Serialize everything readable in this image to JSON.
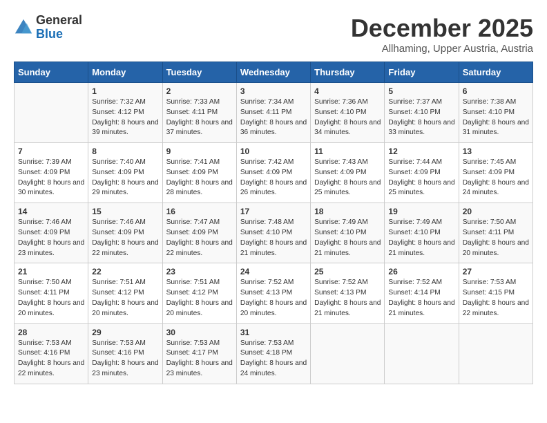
{
  "header": {
    "logo_general": "General",
    "logo_blue": "Blue",
    "title": "December 2025",
    "subtitle": "Allhaming, Upper Austria, Austria"
  },
  "weekdays": [
    "Sunday",
    "Monday",
    "Tuesday",
    "Wednesday",
    "Thursday",
    "Friday",
    "Saturday"
  ],
  "weeks": [
    [
      {
        "day": "",
        "sunrise": "",
        "sunset": "",
        "daylight": ""
      },
      {
        "day": "1",
        "sunrise": "Sunrise: 7:32 AM",
        "sunset": "Sunset: 4:12 PM",
        "daylight": "Daylight: 8 hours and 39 minutes."
      },
      {
        "day": "2",
        "sunrise": "Sunrise: 7:33 AM",
        "sunset": "Sunset: 4:11 PM",
        "daylight": "Daylight: 8 hours and 37 minutes."
      },
      {
        "day": "3",
        "sunrise": "Sunrise: 7:34 AM",
        "sunset": "Sunset: 4:11 PM",
        "daylight": "Daylight: 8 hours and 36 minutes."
      },
      {
        "day": "4",
        "sunrise": "Sunrise: 7:36 AM",
        "sunset": "Sunset: 4:10 PM",
        "daylight": "Daylight: 8 hours and 34 minutes."
      },
      {
        "day": "5",
        "sunrise": "Sunrise: 7:37 AM",
        "sunset": "Sunset: 4:10 PM",
        "daylight": "Daylight: 8 hours and 33 minutes."
      },
      {
        "day": "6",
        "sunrise": "Sunrise: 7:38 AM",
        "sunset": "Sunset: 4:10 PM",
        "daylight": "Daylight: 8 hours and 31 minutes."
      }
    ],
    [
      {
        "day": "7",
        "sunrise": "Sunrise: 7:39 AM",
        "sunset": "Sunset: 4:09 PM",
        "daylight": "Daylight: 8 hours and 30 minutes."
      },
      {
        "day": "8",
        "sunrise": "Sunrise: 7:40 AM",
        "sunset": "Sunset: 4:09 PM",
        "daylight": "Daylight: 8 hours and 29 minutes."
      },
      {
        "day": "9",
        "sunrise": "Sunrise: 7:41 AM",
        "sunset": "Sunset: 4:09 PM",
        "daylight": "Daylight: 8 hours and 28 minutes."
      },
      {
        "day": "10",
        "sunrise": "Sunrise: 7:42 AM",
        "sunset": "Sunset: 4:09 PM",
        "daylight": "Daylight: 8 hours and 26 minutes."
      },
      {
        "day": "11",
        "sunrise": "Sunrise: 7:43 AM",
        "sunset": "Sunset: 4:09 PM",
        "daylight": "Daylight: 8 hours and 25 minutes."
      },
      {
        "day": "12",
        "sunrise": "Sunrise: 7:44 AM",
        "sunset": "Sunset: 4:09 PM",
        "daylight": "Daylight: 8 hours and 25 minutes."
      },
      {
        "day": "13",
        "sunrise": "Sunrise: 7:45 AM",
        "sunset": "Sunset: 4:09 PM",
        "daylight": "Daylight: 8 hours and 24 minutes."
      }
    ],
    [
      {
        "day": "14",
        "sunrise": "Sunrise: 7:46 AM",
        "sunset": "Sunset: 4:09 PM",
        "daylight": "Daylight: 8 hours and 23 minutes."
      },
      {
        "day": "15",
        "sunrise": "Sunrise: 7:46 AM",
        "sunset": "Sunset: 4:09 PM",
        "daylight": "Daylight: 8 hours and 22 minutes."
      },
      {
        "day": "16",
        "sunrise": "Sunrise: 7:47 AM",
        "sunset": "Sunset: 4:09 PM",
        "daylight": "Daylight: 8 hours and 22 minutes."
      },
      {
        "day": "17",
        "sunrise": "Sunrise: 7:48 AM",
        "sunset": "Sunset: 4:10 PM",
        "daylight": "Daylight: 8 hours and 21 minutes."
      },
      {
        "day": "18",
        "sunrise": "Sunrise: 7:49 AM",
        "sunset": "Sunset: 4:10 PM",
        "daylight": "Daylight: 8 hours and 21 minutes."
      },
      {
        "day": "19",
        "sunrise": "Sunrise: 7:49 AM",
        "sunset": "Sunset: 4:10 PM",
        "daylight": "Daylight: 8 hours and 21 minutes."
      },
      {
        "day": "20",
        "sunrise": "Sunrise: 7:50 AM",
        "sunset": "Sunset: 4:11 PM",
        "daylight": "Daylight: 8 hours and 20 minutes."
      }
    ],
    [
      {
        "day": "21",
        "sunrise": "Sunrise: 7:50 AM",
        "sunset": "Sunset: 4:11 PM",
        "daylight": "Daylight: 8 hours and 20 minutes."
      },
      {
        "day": "22",
        "sunrise": "Sunrise: 7:51 AM",
        "sunset": "Sunset: 4:12 PM",
        "daylight": "Daylight: 8 hours and 20 minutes."
      },
      {
        "day": "23",
        "sunrise": "Sunrise: 7:51 AM",
        "sunset": "Sunset: 4:12 PM",
        "daylight": "Daylight: 8 hours and 20 minutes."
      },
      {
        "day": "24",
        "sunrise": "Sunrise: 7:52 AM",
        "sunset": "Sunset: 4:13 PM",
        "daylight": "Daylight: 8 hours and 20 minutes."
      },
      {
        "day": "25",
        "sunrise": "Sunrise: 7:52 AM",
        "sunset": "Sunset: 4:13 PM",
        "daylight": "Daylight: 8 hours and 21 minutes."
      },
      {
        "day": "26",
        "sunrise": "Sunrise: 7:52 AM",
        "sunset": "Sunset: 4:14 PM",
        "daylight": "Daylight: 8 hours and 21 minutes."
      },
      {
        "day": "27",
        "sunrise": "Sunrise: 7:53 AM",
        "sunset": "Sunset: 4:15 PM",
        "daylight": "Daylight: 8 hours and 22 minutes."
      }
    ],
    [
      {
        "day": "28",
        "sunrise": "Sunrise: 7:53 AM",
        "sunset": "Sunset: 4:16 PM",
        "daylight": "Daylight: 8 hours and 22 minutes."
      },
      {
        "day": "29",
        "sunrise": "Sunrise: 7:53 AM",
        "sunset": "Sunset: 4:16 PM",
        "daylight": "Daylight: 8 hours and 23 minutes."
      },
      {
        "day": "30",
        "sunrise": "Sunrise: 7:53 AM",
        "sunset": "Sunset: 4:17 PM",
        "daylight": "Daylight: 8 hours and 23 minutes."
      },
      {
        "day": "31",
        "sunrise": "Sunrise: 7:53 AM",
        "sunset": "Sunset: 4:18 PM",
        "daylight": "Daylight: 8 hours and 24 minutes."
      },
      {
        "day": "",
        "sunrise": "",
        "sunset": "",
        "daylight": ""
      },
      {
        "day": "",
        "sunrise": "",
        "sunset": "",
        "daylight": ""
      },
      {
        "day": "",
        "sunrise": "",
        "sunset": "",
        "daylight": ""
      }
    ]
  ]
}
